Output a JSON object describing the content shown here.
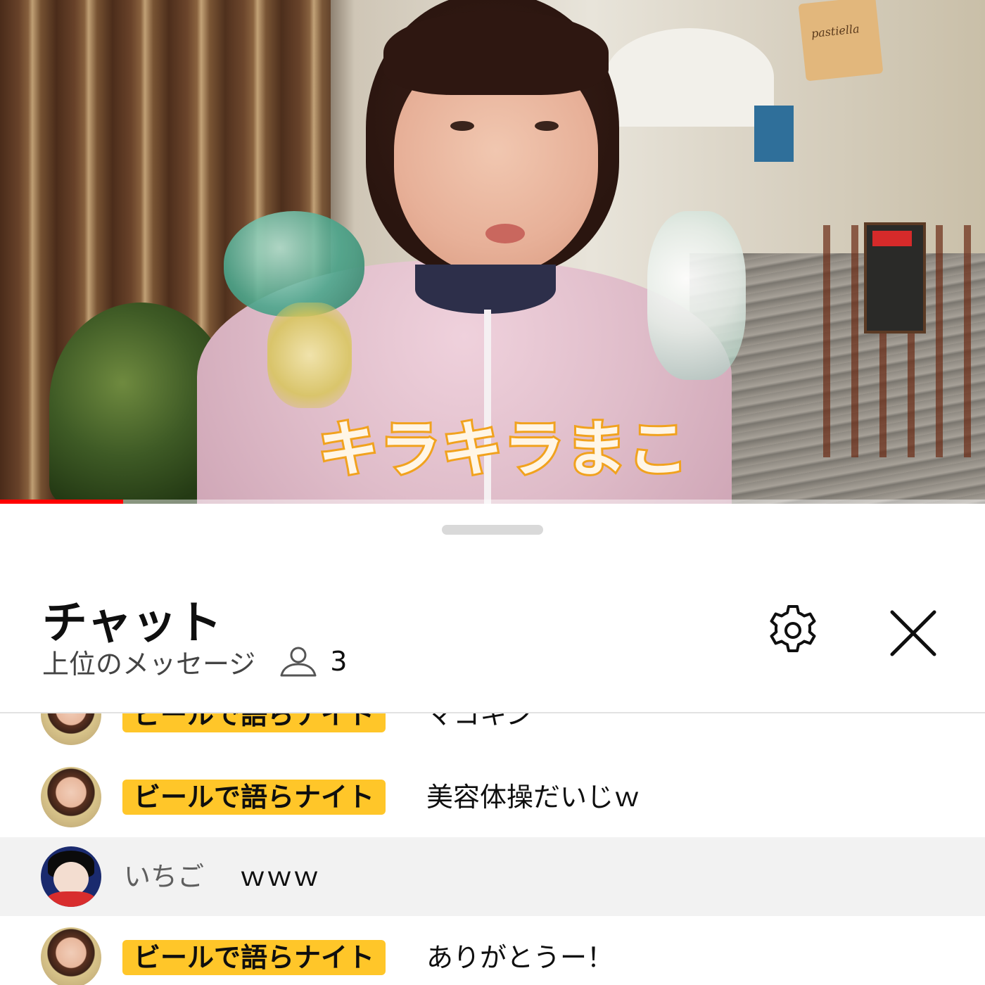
{
  "video": {
    "caption": "キラキラまこ",
    "shop_sign": "pastiella",
    "progress_percent": 12.5
  },
  "chat": {
    "title": "チャット",
    "mode": "上位のメッセージ",
    "viewer_count": "3",
    "messages": [
      {
        "avatar": "avatar-maco",
        "badge": "ビールで語らナイト",
        "author": "",
        "text": "マコキン",
        "highlight": false,
        "partial": true
      },
      {
        "avatar": "avatar-maco",
        "badge": "ビールで語らナイト",
        "author": "",
        "text": "美容体操だいじｗ",
        "highlight": false
      },
      {
        "avatar": "avatar-ichigo",
        "badge": "",
        "author": "いちご",
        "text": "ｗｗｗ",
        "highlight": true
      },
      {
        "avatar": "avatar-maco",
        "badge": "ビールで語らナイト",
        "author": "",
        "text": "ありがとうー！",
        "highlight": false
      }
    ]
  },
  "colors": {
    "member_badge": "#ffc629",
    "progress": "#ff0000",
    "caption_stroke": "#f1a21e"
  },
  "icons": {
    "viewer": "person-outline-icon",
    "settings": "gear-icon",
    "close": "close-icon"
  }
}
